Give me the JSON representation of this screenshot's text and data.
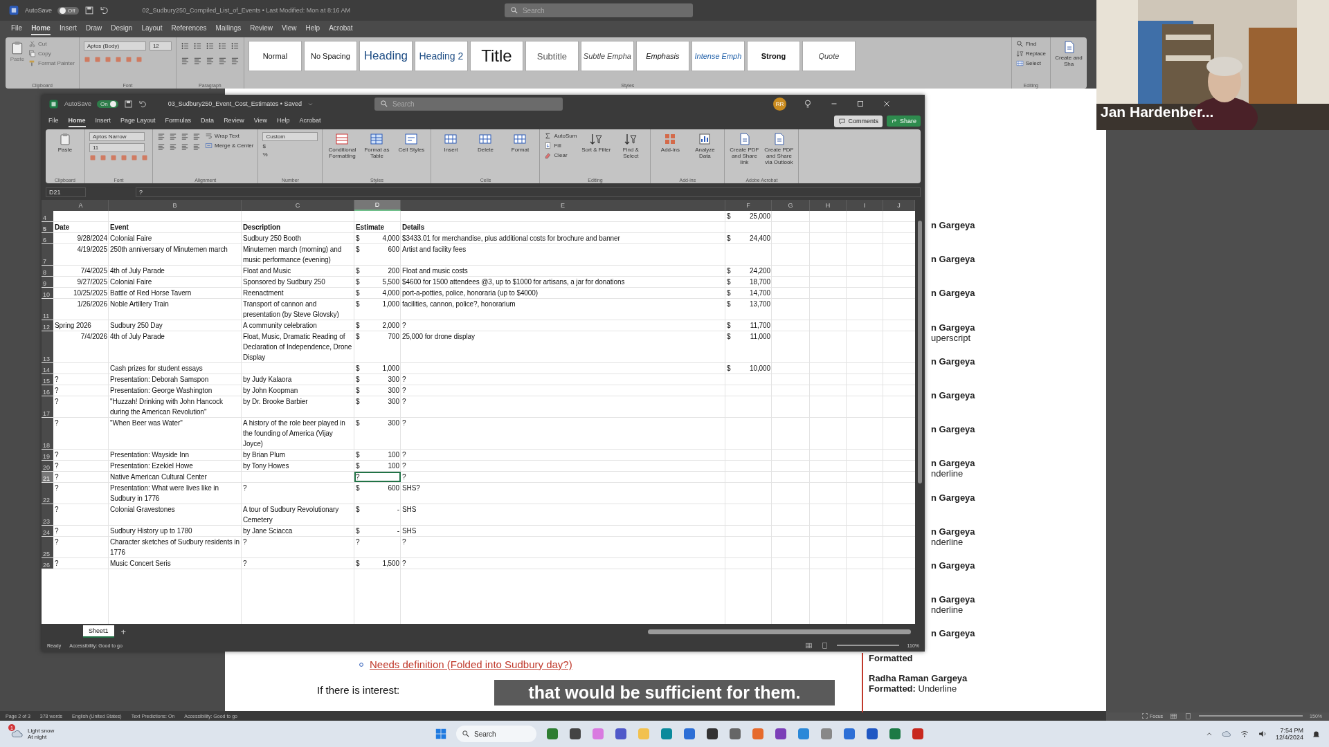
{
  "word": {
    "title": "02_Sudbury250_Compiled_List_of_Events • Last Modified: Mon at 8:16 AM",
    "autosave": {
      "label": "AutoSave",
      "on": false,
      "state": "Off"
    },
    "search": {
      "placeholder": "Search"
    },
    "menu": [
      {
        "label": "File",
        "selected": false
      },
      {
        "label": "Home",
        "selected": true
      },
      {
        "label": "Insert",
        "selected": false
      },
      {
        "label": "Draw",
        "selected": false
      },
      {
        "label": "Design",
        "selected": false
      },
      {
        "label": "Layout",
        "selected": false
      },
      {
        "label": "References",
        "selected": false
      },
      {
        "label": "Mailings",
        "selected": false
      },
      {
        "label": "Review",
        "selected": false
      },
      {
        "label": "View",
        "selected": false
      },
      {
        "label": "Help",
        "selected": false
      },
      {
        "label": "Acrobat",
        "selected": false
      }
    ],
    "ribbon": {
      "clipboard": {
        "paste": "Paste",
        "items": [
          "Cut",
          "Copy",
          "Format Painter"
        ],
        "label": "Clipboard"
      },
      "font": {
        "name": "Aptos (Body)",
        "size": "12",
        "label": "Font"
      },
      "paragraph": {
        "label": "Paragraph"
      },
      "styles": {
        "label": "Styles",
        "items": [
          {
            "label": "Normal",
            "kind": "normal"
          },
          {
            "label": "No Spacing",
            "kind": "nospacing"
          },
          {
            "label": "Heading",
            "kind": "heading"
          },
          {
            "label": "Heading 2",
            "kind": "heading2"
          },
          {
            "label": "Title",
            "kind": "title"
          },
          {
            "label": "Subtitle",
            "kind": "subtitle"
          },
          {
            "label": "Subtle Empha",
            "kind": "subtle"
          },
          {
            "label": "Emphasis",
            "kind": "emphasis"
          },
          {
            "label": "Intense Emph",
            "kind": "intense"
          },
          {
            "label": "Strong",
            "kind": "strong"
          },
          {
            "label": "Quote",
            "kind": "quote"
          }
        ]
      },
      "editing": {
        "items": [
          "Find",
          "Replace",
          "Select"
        ],
        "label": "Editing"
      },
      "create": "Create and Sha"
    },
    "document": [
      {
        "kind": "bullet",
        "text": "Needs definition (Folded into Sudbury day?)"
      },
      {
        "kind": "plain",
        "text": "If there is interest:"
      }
    ],
    "comments": [
      {
        "author": "n Gargeya"
      },
      {
        "author": "n Gargeya"
      },
      {
        "author": "n Gargeya"
      },
      {
        "author": "n Gargeya",
        "detail": "uperscript"
      },
      {
        "author": "n Gargeya"
      },
      {
        "author": "n Gargeya"
      },
      {
        "author": "n Gargeya"
      },
      {
        "author": "n Gargeya",
        "detail": "nderline"
      },
      {
        "author": "n Gargeya"
      },
      {
        "author": "n Gargeya",
        "detail": "nderline"
      },
      {
        "author": "n Gargeya"
      },
      {
        "author": "n Gargeya",
        "detail": "nderline"
      },
      {
        "author": "n Gargeya"
      }
    ],
    "comment_tail": "Formatted",
    "comment_card": {
      "author": "Radha Raman Gargeya",
      "label": "Formatted:",
      "value": "Underline"
    },
    "status_bar": [
      "Page 2 of 3",
      "378 words",
      "English (United States)",
      "Text Predictions: On",
      "Accessibility: Good to go"
    ],
    "status_right": {
      "focus": "Focus",
      "zoom": "150%"
    }
  },
  "excel": {
    "title": "03_Sudbury250_Event_Cost_Estimates • Saved",
    "autosave": {
      "label": "AutoSave",
      "on": true,
      "state": "On"
    },
    "search": {
      "placeholder": "Search"
    },
    "avatar": "RR",
    "menu": [
      {
        "label": "File",
        "selected": false
      },
      {
        "label": "Home",
        "selected": true
      },
      {
        "label": "Insert",
        "selected": false
      },
      {
        "label": "Page Layout",
        "selected": false
      },
      {
        "label": "Formulas",
        "selected": false
      },
      {
        "label": "Data",
        "selected": false
      },
      {
        "label": "Review",
        "selected": false
      },
      {
        "label": "View",
        "selected": false
      },
      {
        "label": "Help",
        "selected": false
      },
      {
        "label": "Acrobat",
        "selected": false
      }
    ],
    "comments_button": "Comments",
    "share_button": "Share",
    "ribbon": [
      {
        "label": "Clipboard",
        "items": [
          {
            "kind": "large",
            "text": "Paste"
          }
        ]
      },
      {
        "label": "Font",
        "items": [
          {
            "kind": "field",
            "text": "Aptos Narrow"
          },
          {
            "kind": "field",
            "text": "11"
          }
        ]
      },
      {
        "label": "Alignment",
        "items": [
          {
            "kind": "small",
            "text": "Wrap Text"
          },
          {
            "kind": "small",
            "text": "Merge & Center"
          }
        ]
      },
      {
        "label": "Number",
        "items": [
          {
            "kind": "field",
            "text": "Custom"
          },
          {
            "kind": "small",
            "text": "$"
          },
          {
            "kind": "small",
            "text": "%"
          }
        ]
      },
      {
        "label": "Styles",
        "items": [
          {
            "kind": "large",
            "text": "Conditional Formatting"
          },
          {
            "kind": "large",
            "text": "Format as Table"
          },
          {
            "kind": "large",
            "text": "Cell Styles"
          }
        ]
      },
      {
        "label": "Cells",
        "items": [
          {
            "kind": "large",
            "text": "Insert"
          },
          {
            "kind": "large",
            "text": "Delete"
          },
          {
            "kind": "large",
            "text": "Format"
          }
        ]
      },
      {
        "label": "Editing",
        "items": [
          {
            "kind": "small",
            "text": "AutoSum"
          },
          {
            "kind": "small",
            "text": "Fill"
          },
          {
            "kind": "small",
            "text": "Clear"
          },
          {
            "kind": "large",
            "text": "Sort & Filter"
          },
          {
            "kind": "large",
            "text": "Find & Select"
          }
        ]
      },
      {
        "label": "Add-ins",
        "items": [
          {
            "kind": "large",
            "text": "Add-ins"
          },
          {
            "kind": "large",
            "text": "Analyze Data"
          }
        ]
      },
      {
        "label": "Adobe Acrobat",
        "items": [
          {
            "kind": "large",
            "text": "Create PDF and Share link"
          },
          {
            "kind": "large",
            "text": "Create PDF and Share via Outlook"
          }
        ]
      }
    ],
    "name_box": "D21",
    "formula": "?",
    "columns": [
      {
        "label": "A",
        "selected": false
      },
      {
        "label": "B",
        "selected": false
      },
      {
        "label": "C",
        "selected": false
      },
      {
        "label": "D",
        "selected": true
      },
      {
        "label": "E",
        "selected": false
      },
      {
        "label": "F",
        "selected": false
      },
      {
        "label": "G",
        "selected": false
      },
      {
        "label": "H",
        "selected": false
      },
      {
        "label": "I",
        "selected": false
      },
      {
        "label": "J",
        "selected": false
      }
    ],
    "rows": [
      {
        "num": "4",
        "kind": "data",
        "selected": false,
        "f_cur": "$",
        "f": "25,000"
      },
      {
        "num": "5",
        "kind": "header",
        "selected": false,
        "a": "Date",
        "b": "Event",
        "c": "Description",
        "d": "Estimate",
        "e": "Details"
      },
      {
        "num": "6",
        "kind": "data",
        "selected": false,
        "date": "9/28/2024",
        "b": "Colonial Faire",
        "c": "Sudbury 250 Booth",
        "d_cur": "$",
        "d": "4,000",
        "e": "$3433.01 for merchandise, plus additional costs for brochure and banner",
        "f_cur": "$",
        "f": "24,400"
      },
      {
        "num": "7",
        "kind": "data",
        "selected": false,
        "date": "4/19/2025",
        "b": "250th anniversary of Minutemen march",
        "c": "Minutemen march (morning) and music performance (evening)",
        "d_cur": "$",
        "d": "600",
        "e": "Artist and facility fees"
      },
      {
        "num": "8",
        "kind": "data",
        "selected": false,
        "date": "7/4/2025",
        "b": "4th of July Parade",
        "c": "Float and Music",
        "d_cur": "$",
        "d": "200",
        "e": "Float and music costs",
        "f_cur": "$",
        "f": "24,200"
      },
      {
        "num": "9",
        "kind": "data",
        "selected": false,
        "date": "9/27/2025",
        "b": "Colonial Faire",
        "c": "Sponsored by Sudbury 250",
        "d_cur": "$",
        "d": "5,500",
        "e": "$4600 for 1500 attendees @3, up to $1000 for artisans, a jar for donations",
        "f_cur": "$",
        "f": "18,700"
      },
      {
        "num": "10",
        "kind": "data",
        "selected": false,
        "date": "10/25/2025",
        "b": "Battle of Red Horse Tavern",
        "c": "Reenactment",
        "d_cur": "$",
        "d": "4,000",
        "e": "port-a-potties, police, honoraria (up to $4000)",
        "f_cur": "$",
        "f": "14,700"
      },
      {
        "num": "11",
        "kind": "data",
        "selected": false,
        "date": "1/26/2026",
        "b": "Noble Artillery Train",
        "c": "Transport of cannon and presentation (by Steve Glovsky)",
        "d_cur": "$",
        "d": "1,000",
        "e": "facilities, cannon, police?, honorarium",
        "f_cur": "$",
        "f": "13,700"
      },
      {
        "num": "12",
        "kind": "data",
        "selected": false,
        "a": "Spring 2026",
        "b": "Sudbury 250 Day",
        "c": "A community celebration",
        "d_cur": "$",
        "d": "2,000",
        "e": "?",
        "f_cur": "$",
        "f": "11,700"
      },
      {
        "num": "13",
        "kind": "data",
        "selected": false,
        "date": "7/4/2026",
        "b": "4th of July Parade",
        "c": "Float, Music, Dramatic Reading of Declaration of Independence, Drone Display",
        "d_cur": "$",
        "d": "700",
        "e": "25,000 for drone display",
        "f_cur": "$",
        "f": "11,000"
      },
      {
        "num": "14",
        "kind": "data",
        "selected": false,
        "b": "Cash prizes for student essays",
        "d_cur": "$",
        "d": "1,000",
        "f_cur": "$",
        "f": "10,000"
      },
      {
        "num": "15",
        "kind": "data",
        "selected": false,
        "a": "?",
        "b": "Presentation: Deborah Samspon",
        "c": "by Judy Kalaora",
        "d_cur": "$",
        "d": "300",
        "e": "?"
      },
      {
        "num": "16",
        "kind": "data",
        "selected": false,
        "a": "?",
        "b": "Presentation: George Washington",
        "c": "by John Koopman",
        "d_cur": "$",
        "d": "300",
        "e": "?"
      },
      {
        "num": "17",
        "kind": "data",
        "selected": false,
        "a": "?",
        "b": "\"Huzzah! Drinking with John Hancock during the American Revolution\"",
        "c": "by Dr. Brooke Barbier",
        "d_cur": "$",
        "d": "300",
        "e": "?"
      },
      {
        "num": "18",
        "kind": "data",
        "selected": false,
        "a": "?",
        "b": "\"When Beer was Water\"",
        "c": "A history of the role beer played in the founding of America (Vijay Joyce)",
        "d_cur": "$",
        "d": "300",
        "e": "?"
      },
      {
        "num": "19",
        "kind": "data",
        "selected": false,
        "a": "?",
        "b": "Presentation: Wayside Inn",
        "c": "by Brian Plum",
        "d_cur": "$",
        "d": "100",
        "e": "?"
      },
      {
        "num": "20",
        "kind": "data",
        "selected": false,
        "a": "?",
        "b": "Presentation: Ezekiel Howe",
        "c": "by Tony Howes",
        "d_cur": "$",
        "d": "100",
        "e": "?"
      },
      {
        "num": "21",
        "kind": "data",
        "selected": true,
        "a": "?",
        "b": "Native American Cultural Center",
        "d": "?",
        "e": "?"
      },
      {
        "num": "22",
        "kind": "data",
        "selected": false,
        "a": "?",
        "b": "Presentation: What were lives like in Sudbury in 1776",
        "c": "?",
        "d_cur": "$",
        "d": "600",
        "e": "SHS?"
      },
      {
        "num": "23",
        "kind": "data",
        "selected": false,
        "a": "?",
        "b": "Colonial Gravestones",
        "c": "A tour of Sudbury Revolutionary Cemetery",
        "d_cur": "$",
        "d": "-",
        "e": "SHS"
      },
      {
        "num": "24",
        "kind": "data",
        "selected": false,
        "a": "?",
        "b": "Sudbury History up to 1780",
        "c": "by Jane Sciacca",
        "d_cur": "$",
        "d": "-",
        "e": "SHS"
      },
      {
        "num": "25",
        "kind": "data",
        "selected": false,
        "a": "?",
        "b": "Character sketches of Sudbury residents in 1776",
        "c": "?",
        "d": "?",
        "e": "?"
      },
      {
        "num": "26",
        "kind": "data",
        "selected": false,
        "a": "?",
        "b": "Music Concert Seris",
        "c": "?",
        "d_cur": "$",
        "d": "1,500",
        "e": "?"
      }
    ],
    "sheets": [
      {
        "label": "Sheet1",
        "selected": true
      }
    ],
    "add_sheet": "+",
    "status": [
      "Ready",
      "Accessibility: Good to go"
    ],
    "zoom": "110%"
  },
  "meeting": {
    "participant": "Jan Hardenber...",
    "caption": "that would be sufficient for them."
  },
  "taskbar": {
    "weather": {
      "badge": "1",
      "title": "Light snow",
      "subtitle": "At night"
    },
    "search": {
      "placeholder": "Search"
    },
    "time": "7:54 PM",
    "date": "12/4/2024"
  }
}
